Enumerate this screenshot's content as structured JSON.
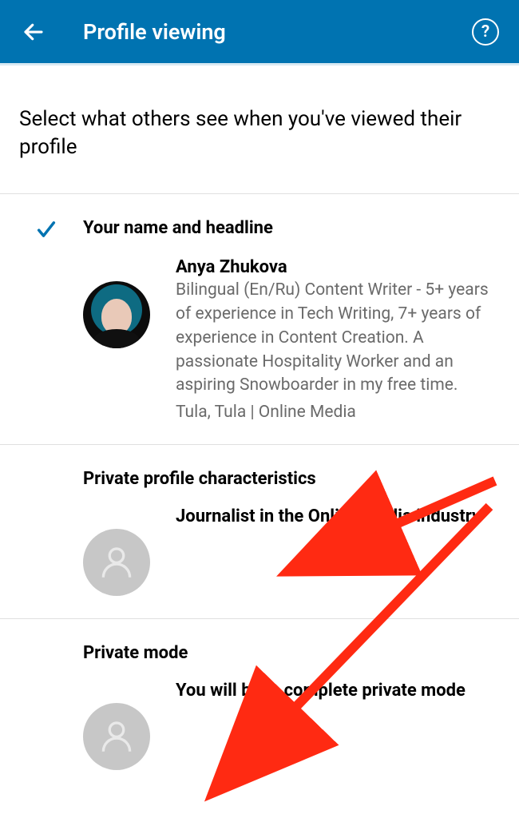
{
  "header": {
    "title": "Profile viewing"
  },
  "instructions": "Select what others see when you've viewed their profile",
  "options": {
    "full": {
      "title": "Your name and headline",
      "name": "Anya Zhukova",
      "headline": "Bilingual (En/Ru) Content Writer - 5+ years of experience in Tech Writing, 7+ years of experience in Content Creation. A passionate Hospitality Worker and an aspiring Snowboarder in my free time.",
      "location": "Tula, Tula | Online Media"
    },
    "semi": {
      "title": "Private profile characteristics",
      "desc": "Journalist in the Online Media industry"
    },
    "private": {
      "title": "Private mode",
      "desc": "You will be in complete private mode"
    }
  }
}
